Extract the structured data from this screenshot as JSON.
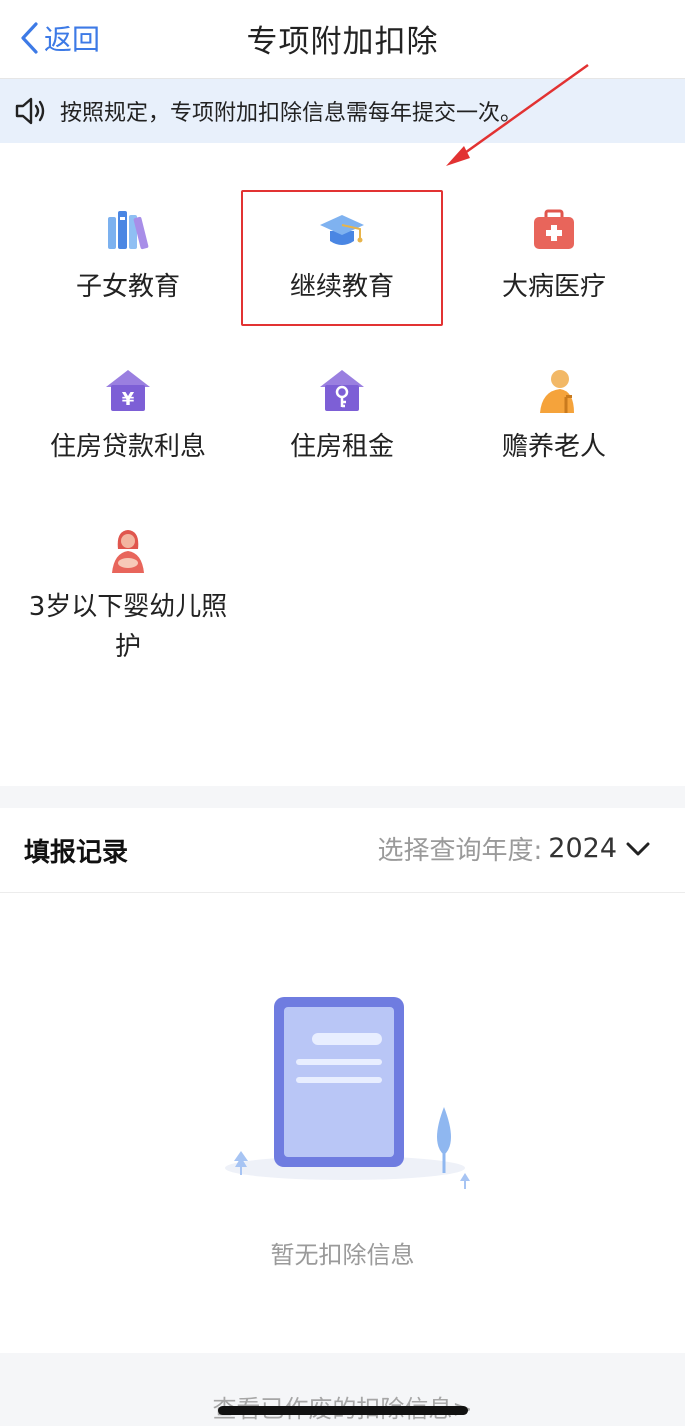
{
  "header": {
    "back_label": "返回",
    "title": "专项附加扣除"
  },
  "notice": {
    "text": "按照规定，专项附加扣除信息需每年提交一次。"
  },
  "categories": [
    {
      "label": "子女教育",
      "icon": "books-icon"
    },
    {
      "label": "继续教育",
      "icon": "graduation-cap-icon"
    },
    {
      "label": "大病医疗",
      "icon": "medical-kit-icon"
    },
    {
      "label": "住房贷款利息",
      "icon": "house-yen-icon"
    },
    {
      "label": "住房租金",
      "icon": "house-key-icon"
    },
    {
      "label": "赡养老人",
      "icon": "elderly-person-icon"
    },
    {
      "label_line1": "3岁以下婴幼儿照",
      "label_line2": "护",
      "icon": "mother-child-icon"
    }
  ],
  "records": {
    "title": "填报记录",
    "year_label": "选择查询年度:",
    "year_value": "2024",
    "empty_text": "暂无扣除信息"
  },
  "footer": {
    "link": "查看已作废的扣除信息>"
  },
  "colors": {
    "accent": "#3d7ae6",
    "highlight": "#e23232",
    "notice_bg": "#e8f0fb"
  }
}
